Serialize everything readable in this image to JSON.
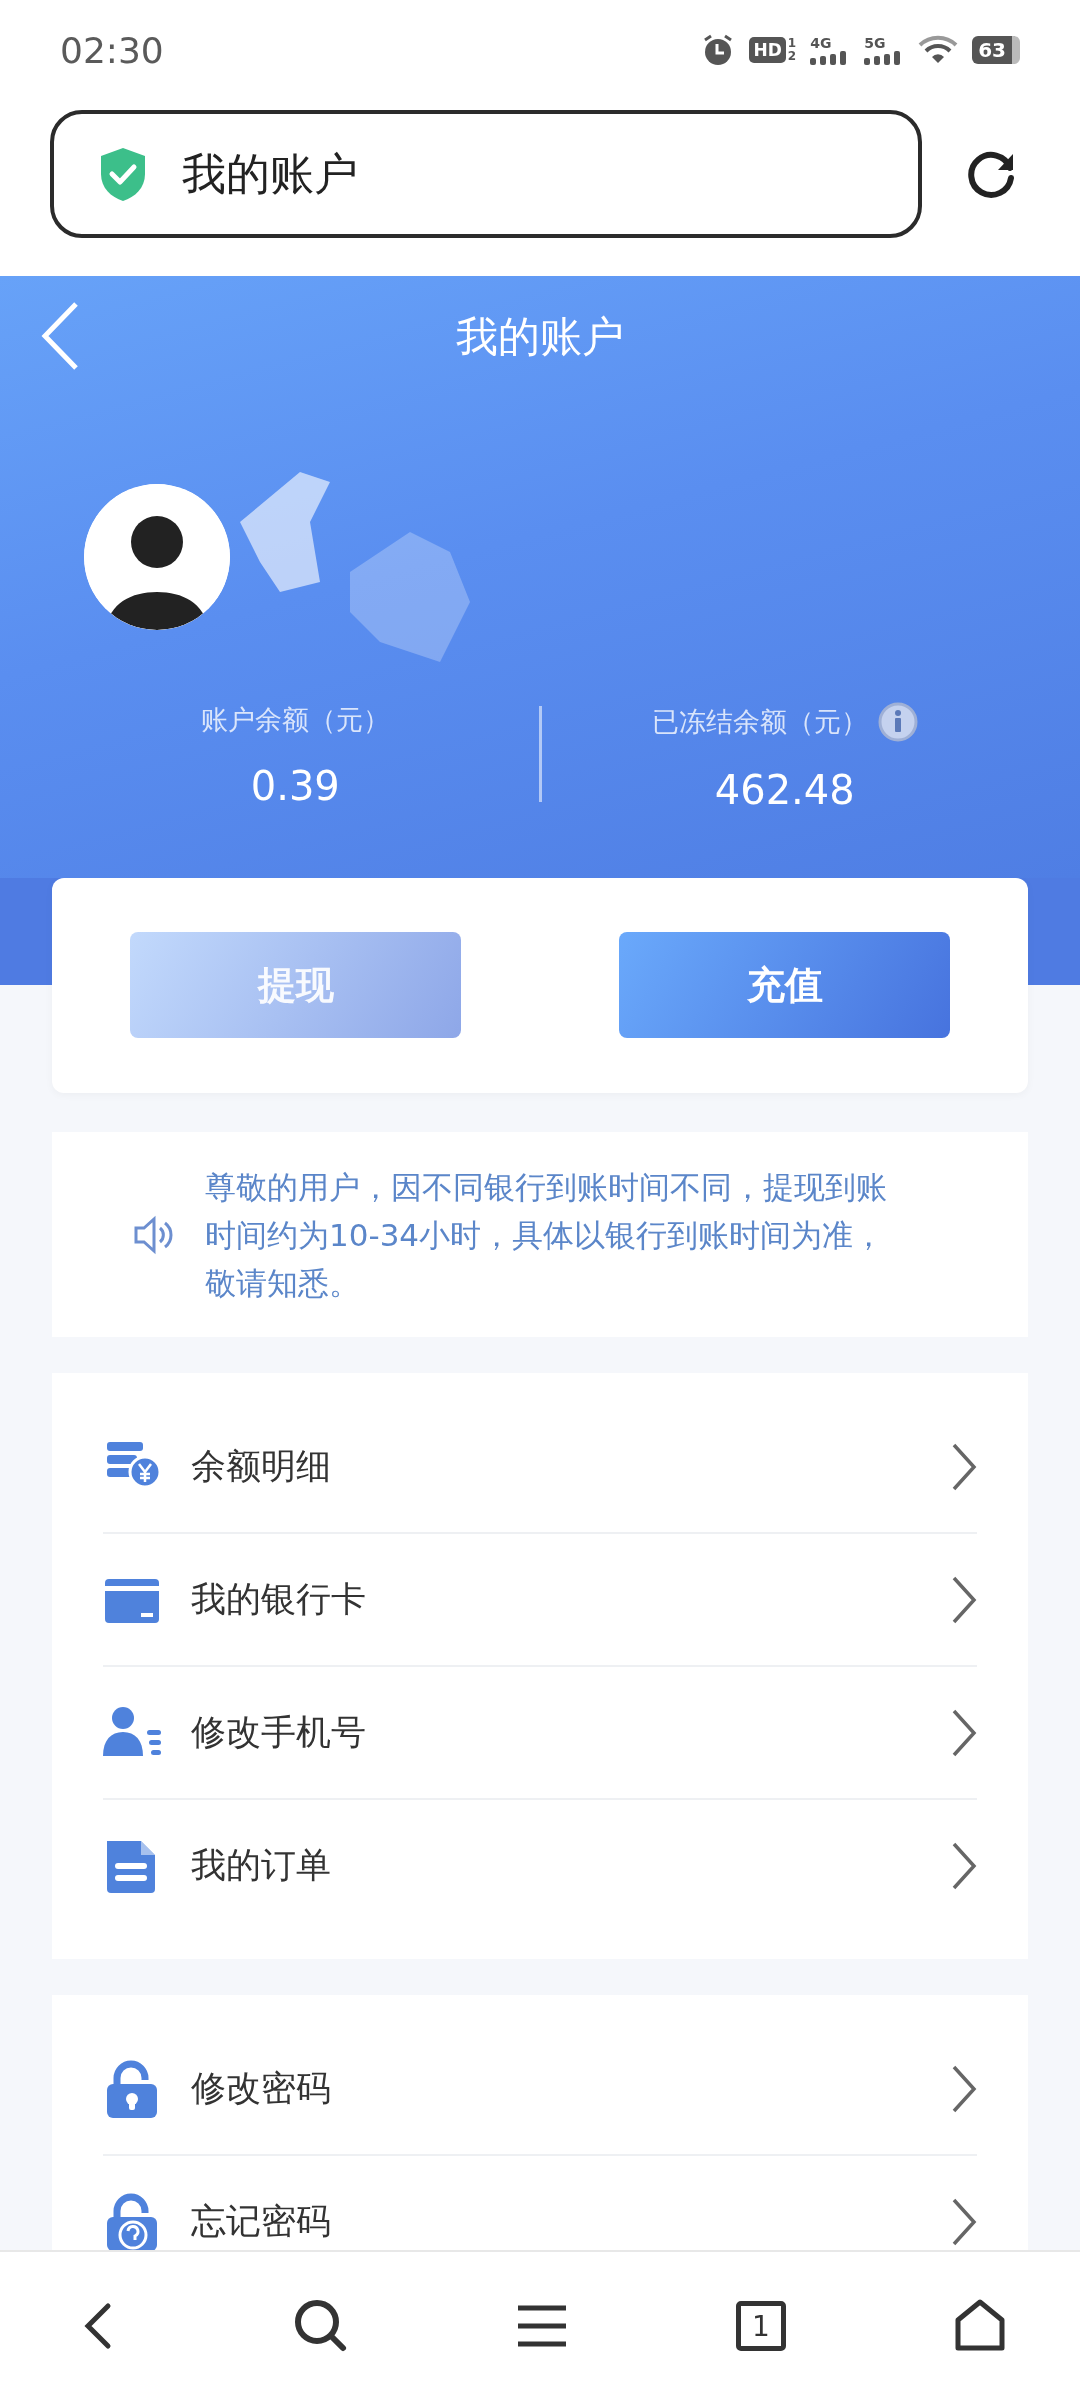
{
  "status_bar": {
    "time": "02:30",
    "hd": "HD",
    "sims": [
      "1",
      "2"
    ],
    "networks": [
      "4G",
      "5G"
    ],
    "battery": "63"
  },
  "address_bar": {
    "title": "我的账户",
    "secure": true
  },
  "header": {
    "title": "我的账户"
  },
  "balances": [
    {
      "label": "账户余额（元）",
      "value": "0.39",
      "info": false
    },
    {
      "label": "已冻结余额（元）",
      "value": "462.48",
      "info": true
    }
  ],
  "actions": [
    {
      "label": "提现",
      "disabled": true
    },
    {
      "label": "充值",
      "disabled": false
    }
  ],
  "notice": {
    "text": "尊敬的用户，因不同银行到账时间不同，提现到账时间约为10-34小时，具体以银行到账时间为准，敬请知悉。"
  },
  "menu_groups": [
    {
      "items": [
        {
          "label": "余额明细",
          "kind": "coins"
        },
        {
          "label": "我的银行卡",
          "kind": "card"
        },
        {
          "label": "修改手机号",
          "kind": "contact"
        },
        {
          "label": "我的订单",
          "kind": "document"
        }
      ]
    },
    {
      "items": [
        {
          "label": "修改密码",
          "kind": "lock"
        },
        {
          "label": "忘记密码",
          "kind": "lockhelp"
        }
      ]
    }
  ],
  "bottom_nav": {
    "tab_count": "1"
  }
}
